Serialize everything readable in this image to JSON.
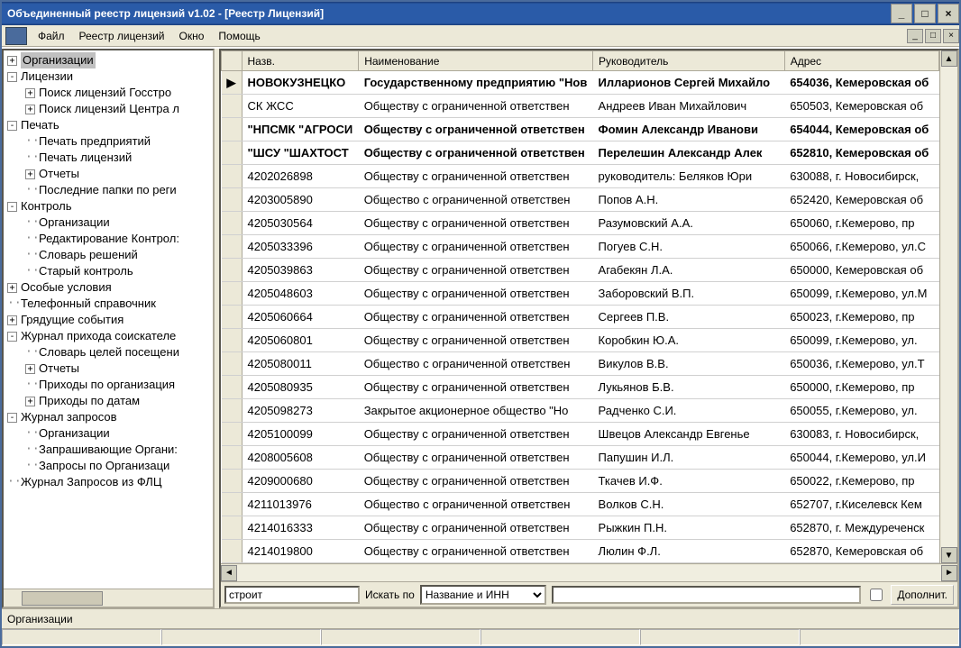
{
  "title": "Объединенный реестр лицензий v1.02 - [Реестр Лицензий]",
  "menu": [
    "Файл",
    "Реестр лицензий",
    "Окно",
    "Помощь"
  ],
  "mdi_btns": [
    "_",
    "□",
    "×"
  ],
  "title_btns": [
    "_",
    "□",
    "×"
  ],
  "tree": [
    {
      "lvl": 0,
      "exp": "+",
      "label": "Организации",
      "sel": true
    },
    {
      "lvl": 0,
      "exp": "-",
      "label": "Лицензии"
    },
    {
      "lvl": 1,
      "exp": "+",
      "label": "Поиск лицензий Госстро"
    },
    {
      "lvl": 1,
      "exp": "+",
      "label": "Поиск лицензий Центра л"
    },
    {
      "lvl": 0,
      "exp": "-",
      "label": "Печать"
    },
    {
      "lvl": 1,
      "exp": "",
      "label": "Печать предприятий"
    },
    {
      "lvl": 1,
      "exp": "",
      "label": "Печать лицензий"
    },
    {
      "lvl": 1,
      "exp": "+",
      "label": "Отчеты"
    },
    {
      "lvl": 1,
      "exp": "",
      "label": "Последние папки по реги"
    },
    {
      "lvl": 0,
      "exp": "-",
      "label": "Контроль"
    },
    {
      "lvl": 1,
      "exp": "",
      "label": "Организации"
    },
    {
      "lvl": 1,
      "exp": "",
      "label": "Редактирование Контрол:"
    },
    {
      "lvl": 1,
      "exp": "",
      "label": "Словарь решений"
    },
    {
      "lvl": 1,
      "exp": "",
      "label": "Старый контроль"
    },
    {
      "lvl": 0,
      "exp": "+",
      "label": "Особые условия"
    },
    {
      "lvl": 0,
      "exp": "",
      "label": "Телефонный справочник"
    },
    {
      "lvl": 0,
      "exp": "+",
      "label": "Грядущие события"
    },
    {
      "lvl": 0,
      "exp": "-",
      "label": "Журнал прихода соискателе"
    },
    {
      "lvl": 1,
      "exp": "",
      "label": "Словарь целей посещени"
    },
    {
      "lvl": 1,
      "exp": "+",
      "label": "Отчеты"
    },
    {
      "lvl": 1,
      "exp": "",
      "label": "Приходы по организация"
    },
    {
      "lvl": 1,
      "exp": "+",
      "label": "Приходы по датам"
    },
    {
      "lvl": 0,
      "exp": "-",
      "label": "Журнал запросов"
    },
    {
      "lvl": 1,
      "exp": "",
      "label": "Организации"
    },
    {
      "lvl": 1,
      "exp": "",
      "label": "Запрашивающие Органи:"
    },
    {
      "lvl": 1,
      "exp": "",
      "label": "Запросы по Организаци"
    },
    {
      "lvl": 0,
      "exp": "",
      "label": "Журнал Запросов из ФЛЦ"
    }
  ],
  "grid": {
    "headers": [
      "Назв.",
      "Наименование",
      "Руководитель",
      "Адрес"
    ],
    "rows": [
      {
        "ind": "▶",
        "c": [
          " НОВОКУЗНЕЦКО",
          "Государственному предприятию \"Нов",
          "Илларионов Сергей Михайло",
          "654036, Кемеровская об"
        ]
      },
      {
        "ind": "",
        "c": [
          " СК ЖСС",
          "Обществу с ограниченной ответствен",
          "Андреев Иван Михайлович",
          "650503, Кемеровская об"
        ]
      },
      {
        "ind": "",
        "c": [
          "\"НПСМК \"АГРОСИ",
          "Обществу с ограниченной ответствен",
          "Фомин Александр Иванови",
          "654044, Кемеровская об"
        ]
      },
      {
        "ind": "",
        "c": [
          "\"ШСУ \"ШАХТОСТ",
          "Обществу с ограниченной ответствен",
          "Перелешин Александр Алек",
          "652810, Кемеровская об"
        ]
      },
      {
        "ind": "",
        "c": [
          "4202026898",
          "Обществу с ограниченной ответствен",
          "руководитель: Беляков Юри",
          "630088, г. Новосибирск,"
        ]
      },
      {
        "ind": "",
        "c": [
          "4203005890",
          "Общество с ограниченной ответствен",
          "Попов А.Н.",
          "652420, Кемеровская об"
        ]
      },
      {
        "ind": "",
        "c": [
          "4205030564",
          "Обществу с ограниченной ответствен",
          "Разумовский А.А.",
          " 650060, г.Кемерово, пр"
        ]
      },
      {
        "ind": "",
        "c": [
          "4205033396",
          "Обществу с ограниченной ответствен",
          "Погуев С.Н.",
          "650066, г.Кемерово, ул.С"
        ]
      },
      {
        "ind": "",
        "c": [
          "4205039863",
          "Обществу с ограниченной ответствен",
          "Агабекян Л.А.",
          "650000, Кемеровская об"
        ]
      },
      {
        "ind": "",
        "c": [
          "4205048603",
          "Обществу с ограниченной ответствен",
          "Заборовский В.П.",
          "650099, г.Кемерово, ул.М"
        ]
      },
      {
        "ind": "",
        "c": [
          "4205060664",
          "Обществу с ограниченной ответствен",
          "Сергеев П.В.",
          "650023, г.Кемерово, пр"
        ]
      },
      {
        "ind": "",
        "c": [
          "4205060801",
          "Обществу с ограниченной ответствен",
          "Коробкин Ю.А.",
          " 650099, г.Кемерово, ул."
        ]
      },
      {
        "ind": "",
        "c": [
          "4205080011",
          "Общество с ограниченной ответствен",
          "Викулов В.В.",
          "650036, г.Кемерово, ул.Т"
        ]
      },
      {
        "ind": "",
        "c": [
          "4205080935",
          "Обществу с ограниченной ответствен",
          "Лукьянов Б.В.",
          "650000, г.Кемерово, пр"
        ]
      },
      {
        "ind": "",
        "c": [
          "4205098273",
          "Закрытое акционерное общество \"Но",
          "Радченко С.И.",
          "650055, г.Кемерово, ул."
        ]
      },
      {
        "ind": "",
        "c": [
          "4205100099",
          "Обществу с ограниченной ответствен",
          "Швецов Александр Евгенье",
          "630083, г. Новосибирск,"
        ]
      },
      {
        "ind": "",
        "c": [
          "4208005608",
          "Обществу с ограниченной ответствен",
          "Папушин И.Л.",
          "650044, г.Кемерово, ул.И"
        ]
      },
      {
        "ind": "",
        "c": [
          "4209000680",
          "Обществу с ограниченной ответствен",
          "Ткачев И.Ф.",
          "650022, г.Кемерово, пр"
        ]
      },
      {
        "ind": "",
        "c": [
          "4211013976",
          "Общество с ограниченной ответствен",
          "Волков С.Н.",
          "652707, г.Киселевск Кем"
        ]
      },
      {
        "ind": "",
        "c": [
          "4214016333",
          "Обществу с ограниченной ответствен",
          "Рыжкин П.Н.",
          "652870, г. Междуреченск"
        ]
      },
      {
        "ind": "",
        "c": [
          "4214019800",
          "Обществу с ограниченной ответствен",
          "Люлин Ф.Л.",
          "652870, Кемеровская об"
        ]
      }
    ]
  },
  "search": {
    "value": "строит",
    "label": "Искать по",
    "combo_value": "Название и ИНН",
    "btn": "Дополнит."
  },
  "status": "Организации"
}
